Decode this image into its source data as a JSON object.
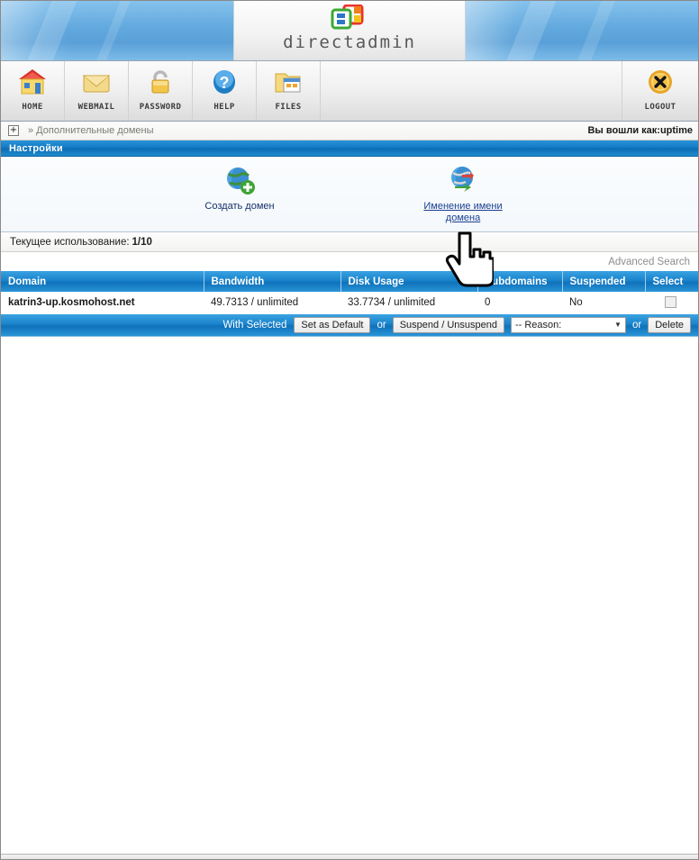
{
  "brand": {
    "wordmark": "directadmin",
    "logo_icon": "directadmin-logo-icon"
  },
  "toolbar": {
    "items": [
      {
        "label": "HOME",
        "icon": "house-icon"
      },
      {
        "label": "WEBMAIL",
        "icon": "envelope-icon"
      },
      {
        "label": "PASSWORD",
        "icon": "padlock-icon"
      },
      {
        "label": "HELP",
        "icon": "question-mark-icon"
      },
      {
        "label": "FILES",
        "icon": "folder-window-icon"
      }
    ],
    "logout": {
      "label": "LOGOUT",
      "icon": "x-circle-icon"
    }
  },
  "breadcrumb": {
    "expand_icon": "plus-box-icon",
    "path": "» Дополнительные домены",
    "logged_in_label": "Вы вошли как:",
    "username": "uptime"
  },
  "section": {
    "title": "Настройки"
  },
  "icon_panel": {
    "items": [
      {
        "label": "Создать домен",
        "icon": "globe-add-icon",
        "is_link": false
      },
      {
        "label": "Именение имени домена",
        "icon": "globe-rename-icon",
        "is_link": true
      }
    ]
  },
  "usage": {
    "label": "Текущее использование:",
    "value": "1/10"
  },
  "search": {
    "advanced_label": "Advanced Search"
  },
  "table": {
    "columns": [
      "Domain",
      "Bandwidth",
      "Disk Usage",
      "Subdomains",
      "Suspended",
      "Select"
    ],
    "rows": [
      {
        "domain": "katrin3-up.kosmohost.net",
        "bandwidth": "49.7313 / unlimited",
        "disk_usage": "33.7734 / unlimited",
        "subdomains": "0",
        "suspended": "No",
        "selected": false
      }
    ]
  },
  "actions": {
    "with_selected_label": "With Selected",
    "set_default_label": "Set as Default",
    "or_label_1": "or",
    "suspend_label": "Suspend / Unsuspend",
    "reason_selected": "-- Reason:",
    "or_label_2": "or",
    "delete_label": "Delete"
  },
  "colors": {
    "accent_blue": "#1a83cb",
    "header_blue": "#0f72bb",
    "link_blue": "#1a3f90",
    "username_red": "#d4221f",
    "banner_blue": "#62a9de"
  }
}
